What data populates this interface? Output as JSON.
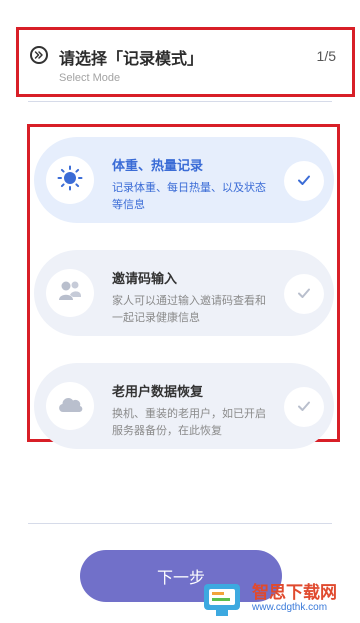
{
  "header": {
    "title": "请选择「记录模式」",
    "subtitle": "Select Mode",
    "step": "1/5",
    "icon": "double-chevron-right-icon"
  },
  "options": [
    {
      "title": "体重、热量记录",
      "description": "记录体重、每日热量、以及状态等信息",
      "icon": "sun-icon",
      "selected": true
    },
    {
      "title": "邀请码输入",
      "description": "家人可以通过输入邀请码查看和一起记录健康信息",
      "icon": "people-icon",
      "selected": false
    },
    {
      "title": "老用户数据恢复",
      "description": "换机、重装的老用户，如已开启服务器备份，在此恢复",
      "icon": "cloud-icon",
      "selected": false
    }
  ],
  "footer": {
    "next_label": "下一步"
  },
  "watermark": {
    "name": "智思下载网",
    "url": "www.cdgthk.com"
  },
  "colors": {
    "accent": "#3b6cd6",
    "button": "#7170c9",
    "highlight_border": "#d81f27",
    "card_bg": "#eef1f8"
  }
}
